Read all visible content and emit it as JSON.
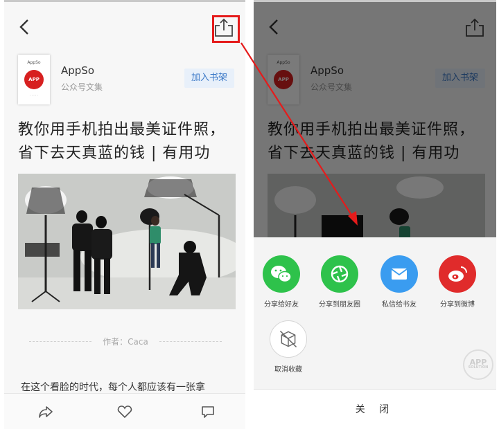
{
  "article": {
    "account_name": "AppSo",
    "account_sub": "公众号文集",
    "add_button": "加入书架",
    "cover_title": "AppSo",
    "cover_badge": "APP",
    "title_line1": "教你用手机拍出最美证件照，",
    "title_line2": "省下去天真蓝的钱 | 有用功",
    "author": "作者：Caca",
    "body_preview": "在这个看脸的时代，每个人都应该有一张拿"
  },
  "share_sheet": {
    "items": [
      {
        "label": "分享给好友",
        "icon": "wechat-icon",
        "color": "#2ec24b"
      },
      {
        "label": "分享到朋友圈",
        "icon": "moments-icon",
        "color": "#2ec24b"
      },
      {
        "label": "私信给书友",
        "icon": "mail-icon",
        "color": "#3a9cf0"
      },
      {
        "label": "分享到微博",
        "icon": "weibo-icon",
        "color": "#e02b2b"
      }
    ],
    "unfavorite": "取消收藏",
    "close": "关 闭"
  },
  "watermark": {
    "main": "APP",
    "sub": "SOLUTION"
  },
  "colors": {
    "highlight": "#e51b1b",
    "accent_blue": "#3a78c7"
  }
}
